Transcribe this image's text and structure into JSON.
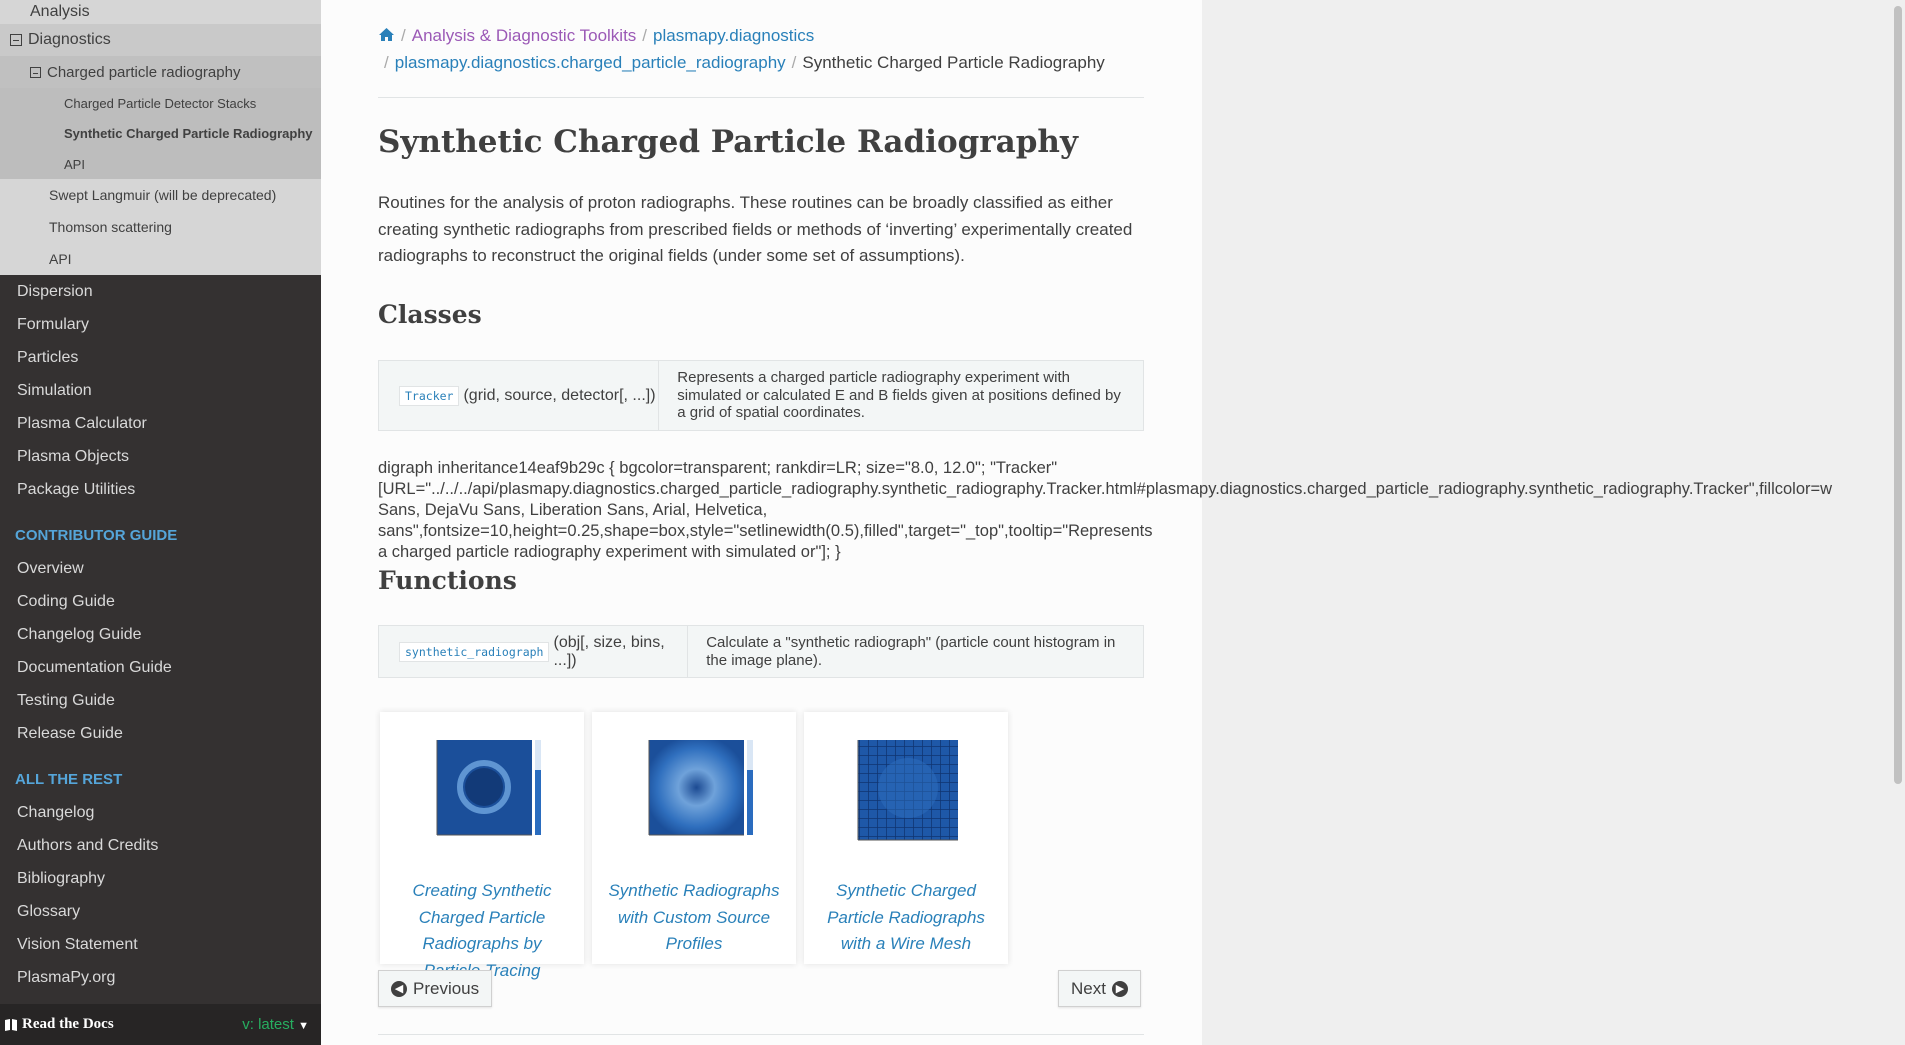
{
  "sidebar": {
    "analysis": "Analysis",
    "diagnostics": "Diagnostics",
    "charged_particle_radiography": "Charged particle radiography",
    "cpr_children": [
      {
        "label": "Charged Particle Detector Stacks"
      },
      {
        "label": "Synthetic Charged Particle Radiography"
      },
      {
        "label": "API"
      }
    ],
    "diag_children": [
      {
        "label": "Swept Langmuir (will be deprecated)"
      },
      {
        "label": "Thomson scattering"
      },
      {
        "label": "API"
      }
    ],
    "main_items": [
      {
        "label": "Dispersion"
      },
      {
        "label": "Formulary"
      },
      {
        "label": "Particles"
      },
      {
        "label": "Simulation"
      },
      {
        "label": "Plasma Calculator"
      },
      {
        "label": "Plasma Objects"
      },
      {
        "label": "Package Utilities"
      }
    ],
    "contributor_caption": "CONTRIBUTOR GUIDE",
    "contributor_items": [
      {
        "label": "Overview"
      },
      {
        "label": "Coding Guide"
      },
      {
        "label": "Changelog Guide"
      },
      {
        "label": "Documentation Guide"
      },
      {
        "label": "Testing Guide"
      },
      {
        "label": "Release Guide"
      }
    ],
    "rest_caption": "ALL THE REST",
    "rest_items": [
      {
        "label": "Changelog"
      },
      {
        "label": "Authors and Credits"
      },
      {
        "label": "Bibliography"
      },
      {
        "label": "Glossary"
      },
      {
        "label": "Vision Statement"
      },
      {
        "label": "PlasmaPy.org"
      }
    ],
    "rtd_label": "Read the Docs",
    "version_label": "v: latest"
  },
  "breadcrumb": {
    "item1": "Analysis & Diagnostic Toolkits",
    "item2": "plasmapy.diagnostics",
    "item3": "plasmapy.diagnostics.charged_particle_radiography",
    "current": "Synthetic Charged Particle Radiography"
  },
  "page": {
    "title": "Synthetic Charged Particle Radiography",
    "intro": "Routines for the analysis of proton radiographs. These routines can be broadly classified as either creating synthetic radiographs from prescribed fields or methods of ‘inverting’ experimentally created radiographs to reconstruct the original fields (under some set of assumptions).",
    "classes_heading": "Classes",
    "class_name": "Tracker",
    "class_sig": "(grid, source, detector[, ...])",
    "class_desc": "Represents a charged particle radiography experiment with simulated or calculated E and B fields given at positions defined by a grid of spatial coordinates.",
    "dot_line1": "digraph inheritance14eaf9b29c { bgcolor=transparent; rankdir=LR; size=\"8.0, 12.0\"; \"Tracker\"",
    "dot_line2": "[URL=\"../../../api/plasmapy.diagnostics.charged_particle_radiography.synthetic_radiography.Tracker.html#plasmapy.diagnostics.charged_particle_radiography.synthetic_radiography.Tracker\",fillcolor=w",
    "dot_line3": "Sans, DejaVu Sans, Liberation Sans, Arial, Helvetica,",
    "dot_line4": "sans\",fontsize=10,height=0.25,shape=box,style=\"setlinewidth(0.5),filled\",target=\"_top\",tooltip=\"Represents",
    "dot_line5": "a charged particle radiography experiment with simulated or\"]; }",
    "functions_heading": "Functions",
    "func_name": "synthetic_radiograph",
    "func_sig": "(obj[, size, bins, ...])",
    "func_desc": "Calculate a \"synthetic radiograph\" (particle count histogram in the image plane).",
    "gallery": [
      {
        "caption": "Creating Synthetic Charged Particle Radiographs by Particle Tracing"
      },
      {
        "caption": "Synthetic Radiographs with Custom Source Profiles"
      },
      {
        "caption": "Synthetic Charged Particle Radiographs with a Wire Mesh"
      }
    ],
    "prev_label": "Previous",
    "next_label": "Next"
  },
  "colors": {
    "sidebar_bg": "#343131",
    "link": "#2980b9",
    "visited": "#9b59b6",
    "caption": "#55a5d9"
  }
}
